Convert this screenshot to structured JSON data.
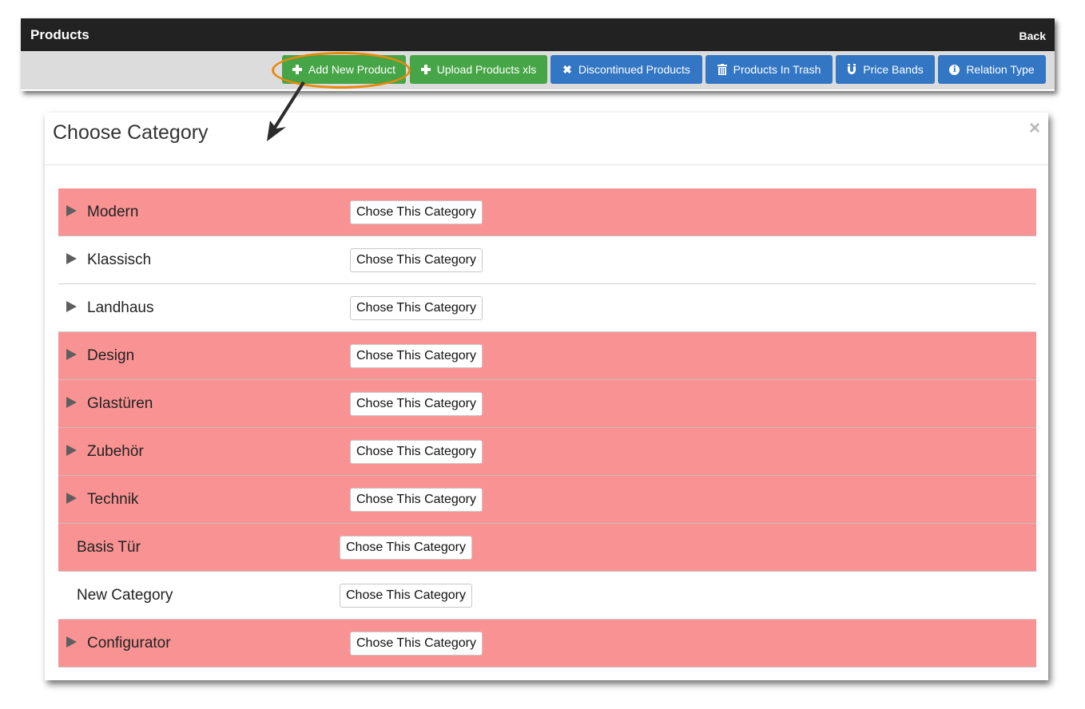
{
  "header": {
    "title": "Products",
    "back_label": "Back"
  },
  "toolbar": {
    "buttons": [
      {
        "label": "Add New Product",
        "icon": "plus-icon",
        "color": "#46a546"
      },
      {
        "label": "Upload Products xls",
        "icon": "plus-icon",
        "color": "#46a546"
      },
      {
        "label": "Discontinued Products",
        "icon": "times-icon",
        "color": "#3276c4"
      },
      {
        "label": "Products In Trash",
        "icon": "trash-icon",
        "color": "#3276c4"
      },
      {
        "label": "Price Bands",
        "icon": "magnet-icon",
        "color": "#3276c4"
      },
      {
        "label": "Relation Type",
        "icon": "info-icon",
        "color": "#3276c4"
      }
    ],
    "annotation_color": "#e8890c"
  },
  "modal": {
    "title": "Choose Category",
    "close_glyph": "×",
    "choose_label": "Chose This Category",
    "highlight_color": "#f99393",
    "categories": [
      {
        "name": "Modern",
        "expandable": true,
        "highlighted": true
      },
      {
        "name": "Klassisch",
        "expandable": true,
        "highlighted": false
      },
      {
        "name": "Landhaus",
        "expandable": true,
        "highlighted": false
      },
      {
        "name": "Design",
        "expandable": true,
        "highlighted": true
      },
      {
        "name": "Glastüren",
        "expandable": true,
        "highlighted": true
      },
      {
        "name": "Zubehör",
        "expandable": true,
        "highlighted": true
      },
      {
        "name": "Technik",
        "expandable": true,
        "highlighted": true
      },
      {
        "name": "Basis Tür",
        "expandable": false,
        "highlighted": true
      },
      {
        "name": "New Category",
        "expandable": false,
        "highlighted": false
      },
      {
        "name": "Configurator",
        "expandable": true,
        "highlighted": true
      }
    ]
  }
}
